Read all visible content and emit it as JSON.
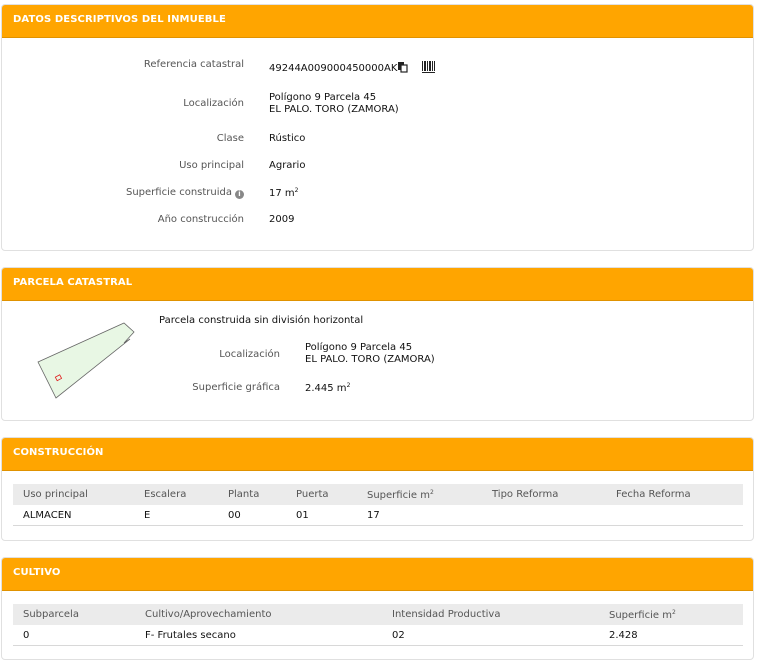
{
  "datos": {
    "title": "DATOS DESCRIPTIVOS DEL INMUEBLE",
    "fields": {
      "referencia_label": "Referencia catastral",
      "referencia_value": "49244A009000450000AK",
      "localizacion_label": "Localización",
      "localizacion_line1": "Polígono 9 Parcela 45",
      "localizacion_line2": "EL PALO. TORO (ZAMORA)",
      "clase_label": "Clase",
      "clase_value": "Rústico",
      "uso_label": "Uso principal",
      "uso_value": "Agrario",
      "superficie_label": "Superficie construida",
      "superficie_value": "17 m",
      "superficie_sup": "2",
      "anio_label": "Año construcción",
      "anio_value": "2009"
    },
    "icons": [
      "copy-icon",
      "barcode-icon",
      "info-icon"
    ]
  },
  "parcela": {
    "title": "PARCELA CATASTRAL",
    "subtitle": "Parcela construida sin división horizontal",
    "localizacion_label": "Localización",
    "localizacion_line1": "Polígono 9 Parcela 45",
    "localizacion_line2": "EL PALO. TORO (ZAMORA)",
    "superficie_label": "Superficie gráfica",
    "superficie_value": "2.445 m",
    "superficie_sup": "2"
  },
  "construccion": {
    "title": "CONSTRUCCIÓN",
    "columns": [
      "Uso principal",
      "Escalera",
      "Planta",
      "Puerta",
      "Superficie m",
      "Tipo Reforma",
      "Fecha Reforma"
    ],
    "sup_col": "2",
    "rows": [
      [
        "ALMACEN",
        "E",
        "00",
        "01",
        "17",
        "",
        ""
      ]
    ]
  },
  "cultivo": {
    "title": "CULTIVO",
    "columns": [
      "Subparcela",
      "Cultivo/Aprovechamiento",
      "Intensidad Productiva",
      "Superficie m"
    ],
    "sup_col": "2",
    "rows": [
      [
        "0",
        "F- Frutales secano",
        "02",
        "2.428"
      ]
    ]
  },
  "colors": {
    "header": "#ffa500",
    "parcel_fill": "#e8f7e4",
    "building_outline": "#e02020"
  }
}
